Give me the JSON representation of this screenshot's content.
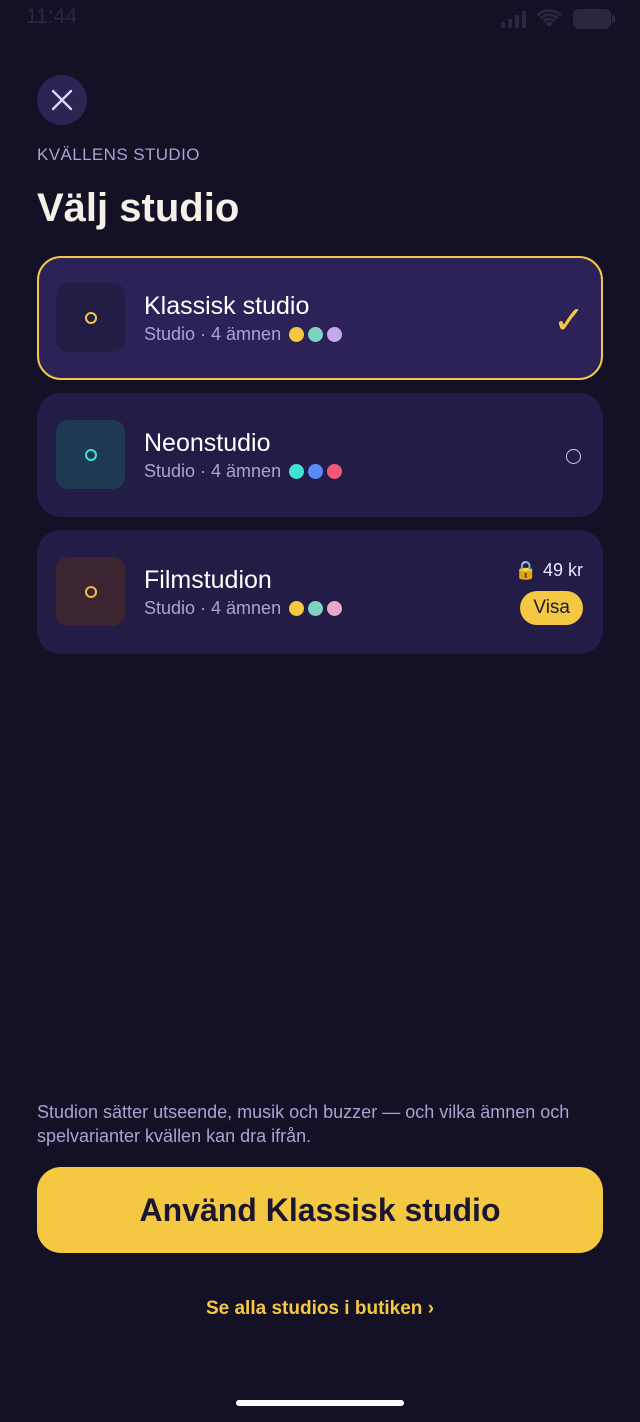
{
  "status_bar": {
    "time": "11:44"
  },
  "header": {
    "close_icon": "close-icon",
    "eyebrow": "KVÄLLENS STUDIO",
    "title": "Välj studio"
  },
  "studios": [
    {
      "name": "Klassisk studio",
      "meta": "Studio · 4 ämnen",
      "thumb_bg": "#221d45",
      "thumb_dot": "#f5c842",
      "swatches": [
        "#f5c842",
        "#7dd3c0",
        "#c4a8f0"
      ],
      "state": "selected",
      "state_icon": "checkmark-icon",
      "check": "✓"
    },
    {
      "name": "Neonstudio",
      "meta": "Studio · 4 ämnen",
      "thumb_bg": "#1d3a52",
      "thumb_dot": "#3fe3d5",
      "swatches": [
        "#3fe3d5",
        "#5b8cf5",
        "#f5557a"
      ],
      "state": "unselected",
      "state_icon": "radio-icon"
    },
    {
      "name": "Filmstudion",
      "meta": "Studio · 4 ämnen",
      "thumb_bg": "#3a2530",
      "thumb_dot": "#f5b84a",
      "swatches": [
        "#f5c842",
        "#7dd3c0",
        "#e8a8c8"
      ],
      "state": "locked",
      "state_icon": "lock-icon",
      "price": "49 kr",
      "lock": "🔒",
      "action": "Visa"
    }
  ],
  "footer": {
    "note": "Studion sätter utseende, musik och buzzer — och vilka ämnen och spelvarianter kvällen kan dra ifrån.",
    "primary_button": "Använd Klassisk studio",
    "store_link": "Se alla studios i butiken ›"
  },
  "colors": {
    "background": "#141127",
    "card": "#221c47",
    "card_selected": "#2c2257",
    "accent": "#f5c842",
    "muted_text": "#a9a3cf"
  }
}
